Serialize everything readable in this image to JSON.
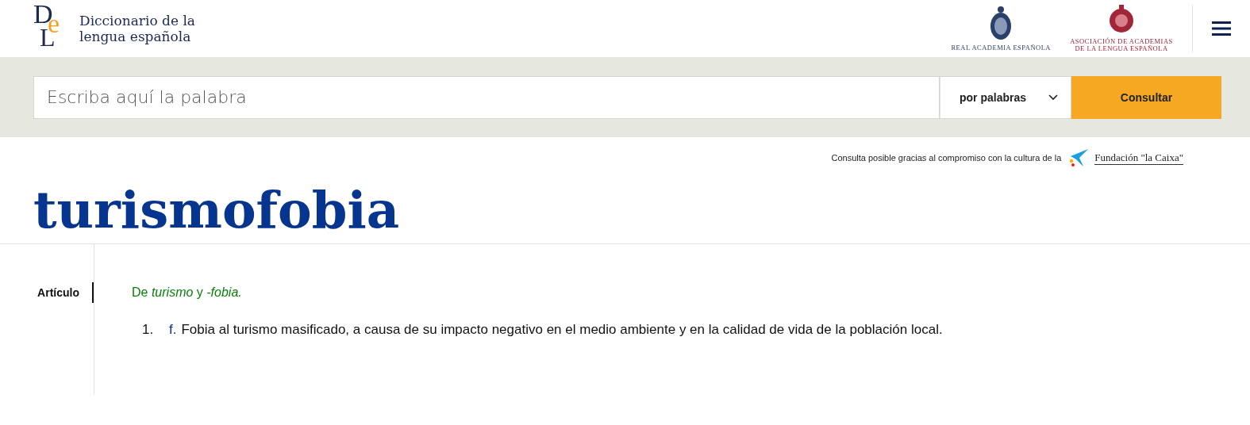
{
  "header": {
    "logo_letters": {
      "d": "D",
      "l": "L",
      "e": "e"
    },
    "site_title_lines": [
      "Diccionario de la",
      "lengua española"
    ],
    "partners": [
      {
        "kind": "rae",
        "caption": "REAL ACADEMIA ESPAÑOLA"
      },
      {
        "kind": "asale",
        "caption": "ASOCIACIÓN DE ACADEMIAS DE LA LENGUA ESPAÑOLA"
      }
    ]
  },
  "search": {
    "placeholder": "Escriba aquí la palabra",
    "mode": "por palabras",
    "button": "Consultar"
  },
  "sponsor": {
    "text": "Consulta posible gracias al compromiso con la cultura de la",
    "brand": "Fundación \"la Caixa\""
  },
  "entry": {
    "headword": "turismofobia",
    "nav": [
      {
        "label": "Artículo",
        "selected": true
      }
    ],
    "etymology": "De *turismo* y *-fobia.*",
    "senses": [
      {
        "number": "1.",
        "abbr": "f.",
        "definition": "Fobia al turismo masificado, a causa de su impacto negativo en el medio ambiente y en la calidad de vida de la población local."
      }
    ]
  }
}
